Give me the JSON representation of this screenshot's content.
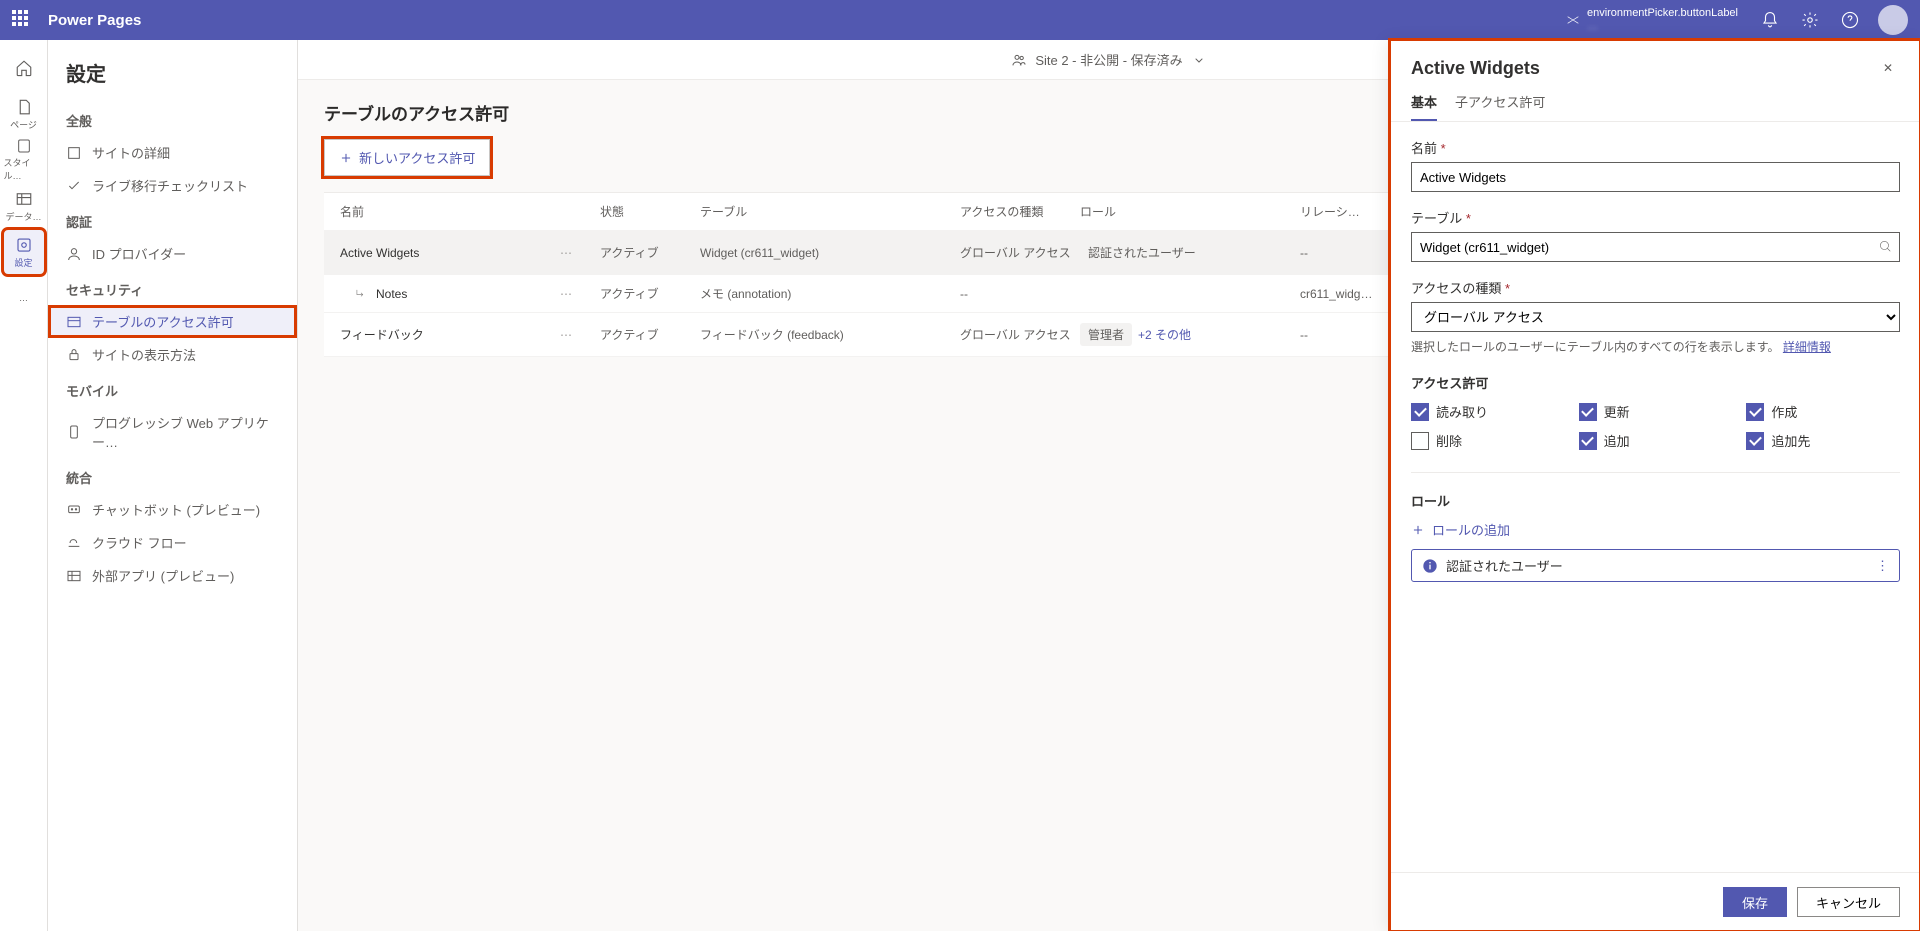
{
  "header": {
    "brand": "Power Pages",
    "env_label": "environmentPicker.buttonLabel",
    "env_sub": "…"
  },
  "rail": {
    "home": "",
    "page": "ページ",
    "style": "スタイル…",
    "data": "データ…",
    "setup": "設定",
    "more": "…"
  },
  "sidebar": {
    "title": "設定",
    "groups": {
      "general": {
        "label": "全般",
        "items": [
          {
            "label": "サイトの詳細"
          },
          {
            "label": "ライブ移行チェックリスト"
          }
        ]
      },
      "auth": {
        "label": "認証",
        "items": [
          {
            "label": "ID プロバイダー"
          }
        ]
      },
      "security": {
        "label": "セキュリティ",
        "items": [
          {
            "label": "テーブルのアクセス許可",
            "active": true
          },
          {
            "label": "サイトの表示方法"
          }
        ]
      },
      "mobile": {
        "label": "モバイル",
        "items": [
          {
            "label": "プログレッシブ Web アプリケー…"
          }
        ]
      },
      "integrate": {
        "label": "統合",
        "items": [
          {
            "label": "チャットボット (プレビュー)"
          },
          {
            "label": "クラウド フロー"
          },
          {
            "label": "外部アプリ (プレビュー)"
          }
        ]
      }
    }
  },
  "site_bar": {
    "text": "Site 2 - 非公開 - 保存済み"
  },
  "main": {
    "title": "テーブルのアクセス許可",
    "new_btn": "新しいアクセス許可",
    "cols": {
      "name": "名前",
      "state": "状態",
      "table": "テーブル",
      "access": "アクセスの種類",
      "role": "ロール",
      "relation": "リレーシ…"
    },
    "rows": [
      {
        "name": "Active Widgets",
        "state": "アクティブ",
        "table": "Widget (cr611_widget)",
        "access": "グローバル アクセス",
        "role_chip": "認証されたユーザー",
        "role_more": "",
        "relation": "--"
      },
      {
        "name": "Notes",
        "child": true,
        "state": "アクティブ",
        "table": "メモ (annotation)",
        "access": "--",
        "role_chip": "",
        "role_more": "",
        "relation": "cr611_widg…"
      },
      {
        "name": "フィードバック",
        "state": "アクティブ",
        "table": "フィードバック (feedback)",
        "access": "グローバル アクセス",
        "role_chip": "管理者",
        "role_more": "+2 その他",
        "relation": "--"
      }
    ]
  },
  "panel": {
    "title": "Active Widgets",
    "tabs": {
      "basic": "基本",
      "child": "子アクセス許可"
    },
    "name_label": "名前",
    "name_value": "Active Widgets",
    "table_label": "テーブル",
    "table_value": "Widget (cr611_widget)",
    "access_label": "アクセスの種類",
    "access_value": "グローバル アクセス",
    "hint_text": "選択したロールのユーザーにテーブル内のすべての行を表示します。",
    "hint_link": "詳細情報",
    "perm_title": "アクセス許可",
    "perms": {
      "read": "読み取り",
      "update": "更新",
      "create": "作成",
      "delete": "削除",
      "append": "追加",
      "appendto": "追加先"
    },
    "role_title": "ロール",
    "add_role": "ロールの追加",
    "role_entry": "認証されたユーザー",
    "save": "保存",
    "cancel": "キャンセル"
  }
}
